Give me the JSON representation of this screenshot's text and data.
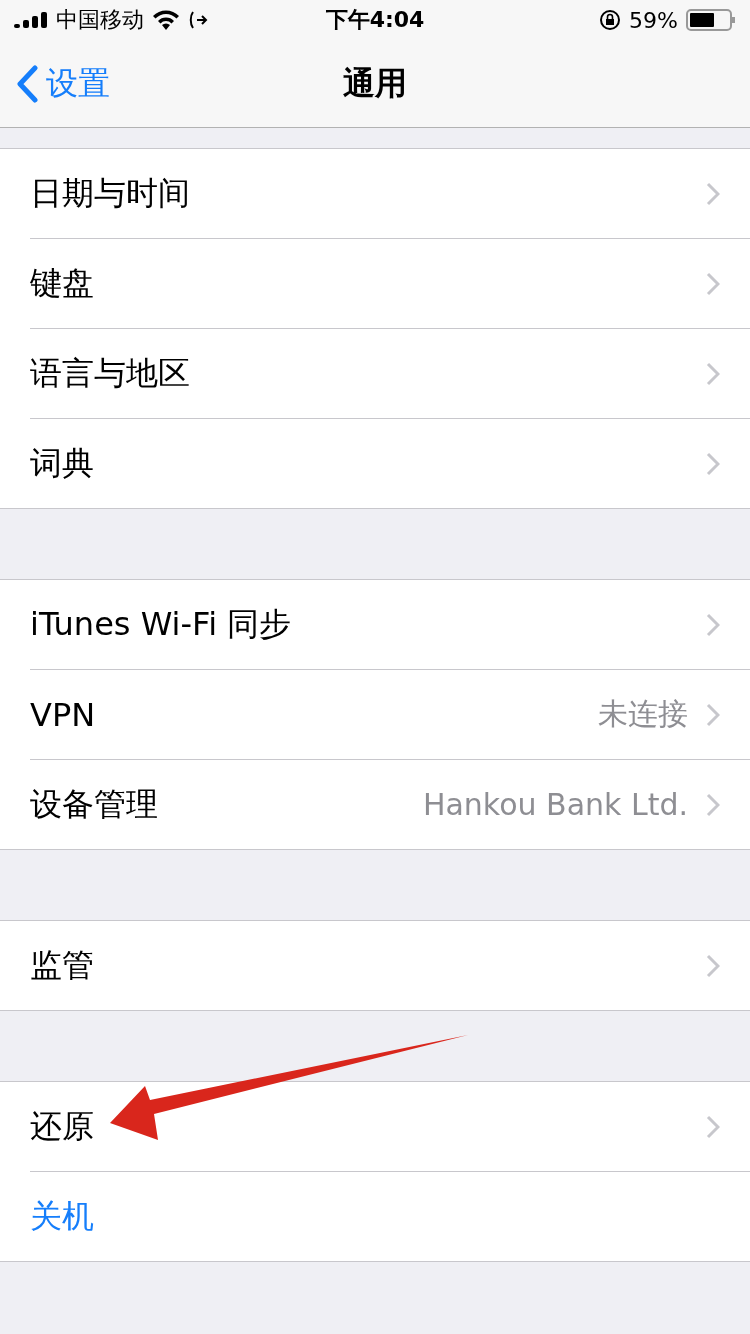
{
  "status_bar": {
    "carrier": "中国移动",
    "time": "下午4:04",
    "battery": "59%"
  },
  "nav": {
    "back": "设置",
    "title": "通用"
  },
  "groups": [
    {
      "rows": [
        {
          "kind": "nav",
          "label": "日期与时间"
        },
        {
          "kind": "nav",
          "label": "键盘"
        },
        {
          "kind": "nav",
          "label": "语言与地区"
        },
        {
          "kind": "nav",
          "label": "词典"
        }
      ]
    },
    {
      "rows": [
        {
          "kind": "nav",
          "label": "iTunes Wi-Fi 同步"
        },
        {
          "kind": "nav",
          "label": "VPN",
          "value": "未连接"
        },
        {
          "kind": "nav",
          "label": "设备管理",
          "value": "Hankou Bank Ltd."
        }
      ]
    },
    {
      "rows": [
        {
          "kind": "nav",
          "label": "监管"
        }
      ]
    },
    {
      "rows": [
        {
          "kind": "nav",
          "label": "还原"
        },
        {
          "kind": "action",
          "label": "关机"
        }
      ]
    }
  ]
}
